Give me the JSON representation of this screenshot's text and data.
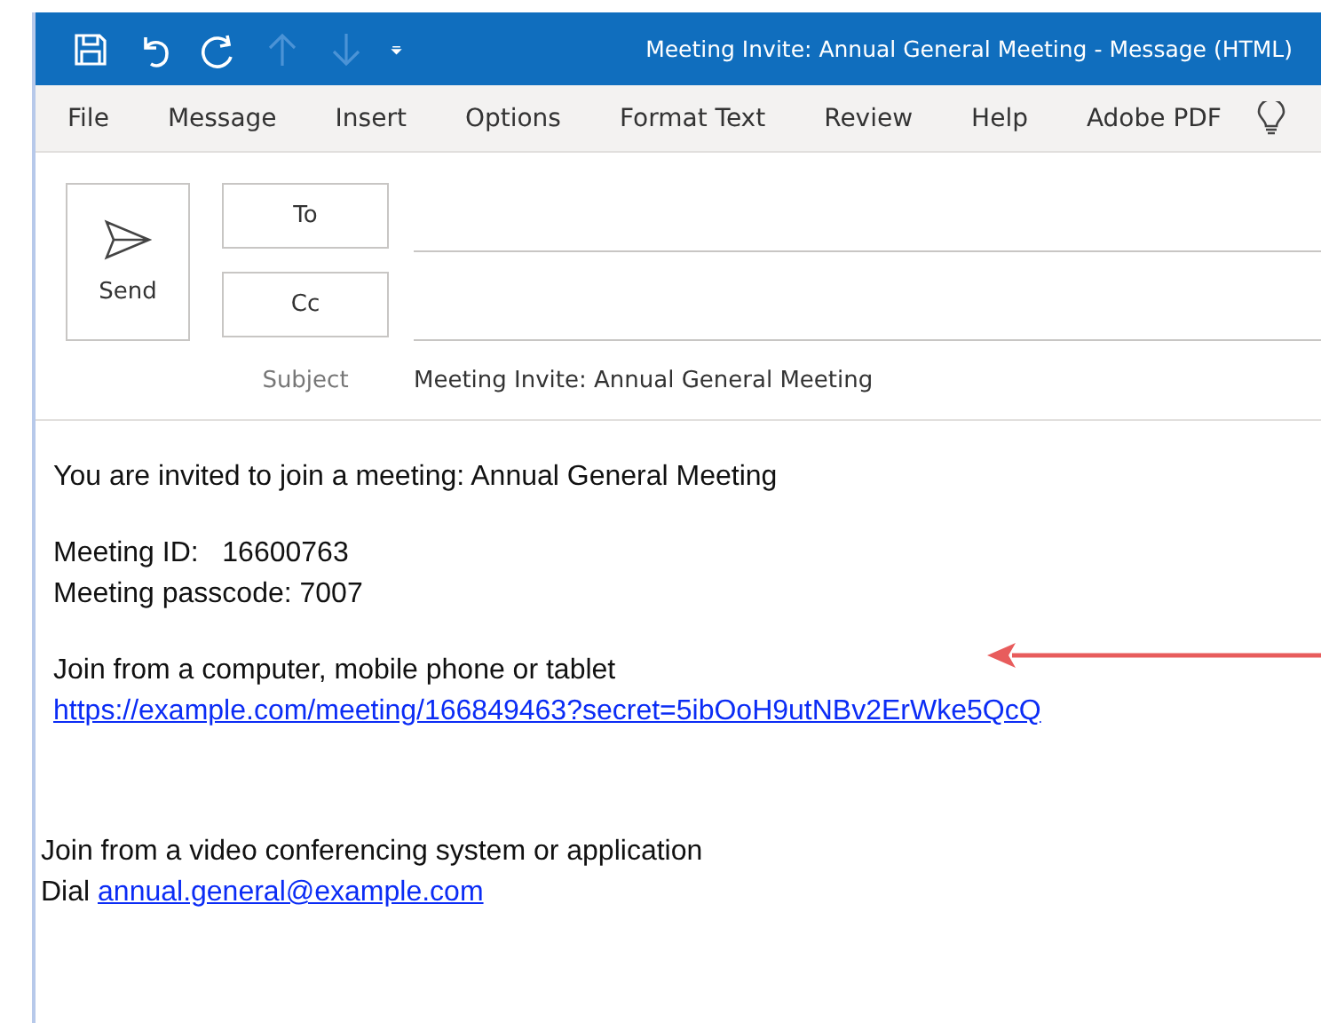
{
  "window": {
    "title": "Meeting Invite: Annual General Meeting  -  Message (HTML)"
  },
  "menu": [
    {
      "label": "File"
    },
    {
      "label": "Message"
    },
    {
      "label": "Insert"
    },
    {
      "label": "Options"
    },
    {
      "label": "Format Text"
    },
    {
      "label": "Review"
    },
    {
      "label": "Help"
    },
    {
      "label": "Adobe PDF"
    }
  ],
  "compose": {
    "send": "Send",
    "to": "To",
    "cc": "Cc",
    "subject_label": "Subject",
    "subject": "Meeting Invite: Annual General Meeting"
  },
  "paragraphs": [
    {
      "outdent": false,
      "spaced": false,
      "lines": [
        {
          "kind": "text",
          "text": "You are invited to join a meeting: Annual General Meeting"
        }
      ]
    },
    {
      "outdent": false,
      "spaced": false,
      "lines": [
        {
          "kind": "text",
          "text": "Meeting ID:   16600763"
        },
        {
          "kind": "text",
          "text": "Meeting passcode: 7007"
        }
      ]
    },
    {
      "outdent": false,
      "spaced": false,
      "lines": [
        {
          "kind": "text",
          "text": "Join from a computer, mobile phone or tablet"
        },
        {
          "kind": "link",
          "text": "https://example.com/meeting/166849463?secret=5ibOoH9utNBv2ErWke5QcQ"
        }
      ]
    },
    {
      "outdent": true,
      "spaced": true,
      "lines": [
        {
          "kind": "text",
          "text": "Join from a video conferencing system or application"
        },
        {
          "kind": "dial",
          "prefix": "Dial",
          "text": "annual.general@example.com"
        }
      ]
    }
  ]
}
